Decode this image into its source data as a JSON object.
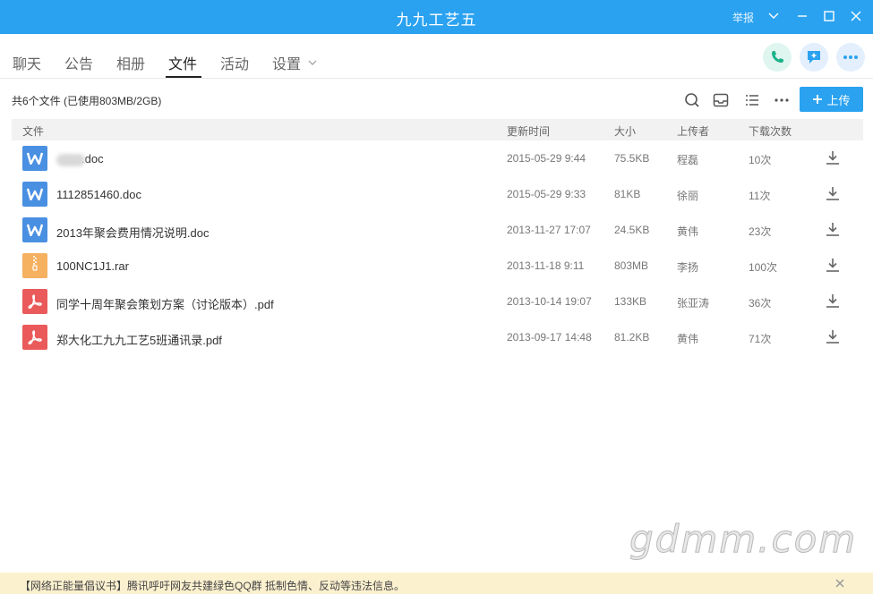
{
  "window": {
    "title": "九九工艺五",
    "report_label": "举报"
  },
  "tabs": [
    {
      "label": "聊天"
    },
    {
      "label": "公告"
    },
    {
      "label": "相册"
    },
    {
      "label": "文件",
      "active": true
    },
    {
      "label": "活动"
    },
    {
      "label": "设置"
    }
  ],
  "header_actions": {
    "call_icon": "phone-icon",
    "message_icon": "add-message-icon",
    "more_icon": "more-icon"
  },
  "toolbar": {
    "summary": "共6个文件 (已使用803MB/2GB)",
    "upload_label": "上传",
    "icons": [
      "search-icon",
      "inbox-icon",
      "list-view-icon",
      "more-icon"
    ]
  },
  "table": {
    "columns": [
      "文件",
      "更新时间",
      "大小",
      "上传者",
      "下载次数"
    ],
    "rows": [
      {
        "type": "doc",
        "name": ".doc",
        "name_redacted": true,
        "time": "2015-05-29 9:44",
        "size": "75.5KB",
        "uploader": "程磊",
        "downloads": "10次"
      },
      {
        "type": "doc",
        "name": "1112851460.doc",
        "time": "2015-05-29 9:33",
        "size": "81KB",
        "uploader": "徐丽",
        "downloads": "11次"
      },
      {
        "type": "doc",
        "name": "2013年聚会费用情况说明.doc",
        "time": "2013-11-27 17:07",
        "size": "24.5KB",
        "uploader": "黄伟",
        "downloads": "23次"
      },
      {
        "type": "rar",
        "name": "100NC1J1.rar",
        "time": "2013-11-18 9:11",
        "size": "803MB",
        "uploader": "李扬",
        "downloads": "100次"
      },
      {
        "type": "pdf",
        "name": "同学十周年聚会策划方案（讨论版本）.pdf",
        "time": "2013-10-14 19:07",
        "size": "133KB",
        "uploader": "张亚涛",
        "downloads": "36次"
      },
      {
        "type": "pdf",
        "name": "郑大化工九九工艺5班通讯录.pdf",
        "time": "2013-09-17 14:48",
        "size": "81.2KB",
        "uploader": "黄伟",
        "downloads": "71次"
      }
    ]
  },
  "watermark": "gdmm.com",
  "banner": {
    "text": "【网络正能量倡议书】腾讯呼吁网友共建绿色QQ群 抵制色情、反动等违法信息。"
  },
  "colors": {
    "accent": "#2aa2f0",
    "doc": "#4a90e2",
    "rar": "#f5b060",
    "pdf": "#ea5a5a",
    "banner_bg": "#fcf1cf"
  }
}
